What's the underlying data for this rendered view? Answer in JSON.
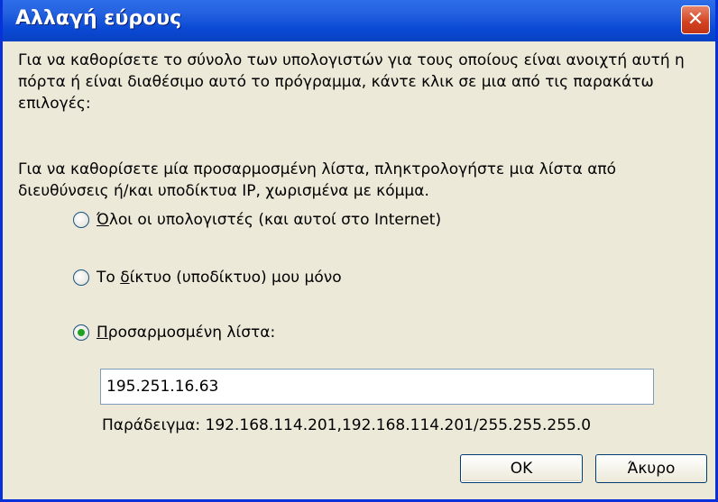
{
  "dialog": {
    "title": "Αλλαγή εύρους",
    "close_symbol": "✕",
    "description1": "Για να καθορίσετε το σύνολο των υπολογιστών για τους οποίους είναι ανοιχτή αυτή η πόρτα ή είναι διαθέσιμο αυτό το πρόγραμμα, κάντε κλικ σε μια από τις παρακάτω επιλογές:",
    "description2": "Για να καθορίσετε μία προσαρμοσμένη λίστα, πληκτρολογήστε μια λίστα από διευθύνσεις ή/και υποδίκτυα IP, χωρισμένα με κόμμα.",
    "options": [
      {
        "label_first": "Ό",
        "label_rest": "λοι οι υπολογιστές (και αυτοί στο Internet)",
        "checked": false
      },
      {
        "label_prefix": "Το ",
        "label_first": "δ",
        "label_rest": "ίκτυο (υποδίκτυο) μου μόνο",
        "checked": false
      },
      {
        "label_first": "Π",
        "label_rest": "ροσαρμοσμένη λίστα:",
        "checked": true
      }
    ],
    "custom_list_value": "195.251.16.63",
    "example": "Παράδειγμα: 192.168.114.201,192.168.114.201/255.255.255.0",
    "ok_label": "OK",
    "cancel_label": "Άκυρο"
  },
  "colors": {
    "title_bar": "#0a49d4",
    "window_bg": "#ece9d8",
    "close": "#d2421f",
    "radio_dot": "#21a121"
  }
}
